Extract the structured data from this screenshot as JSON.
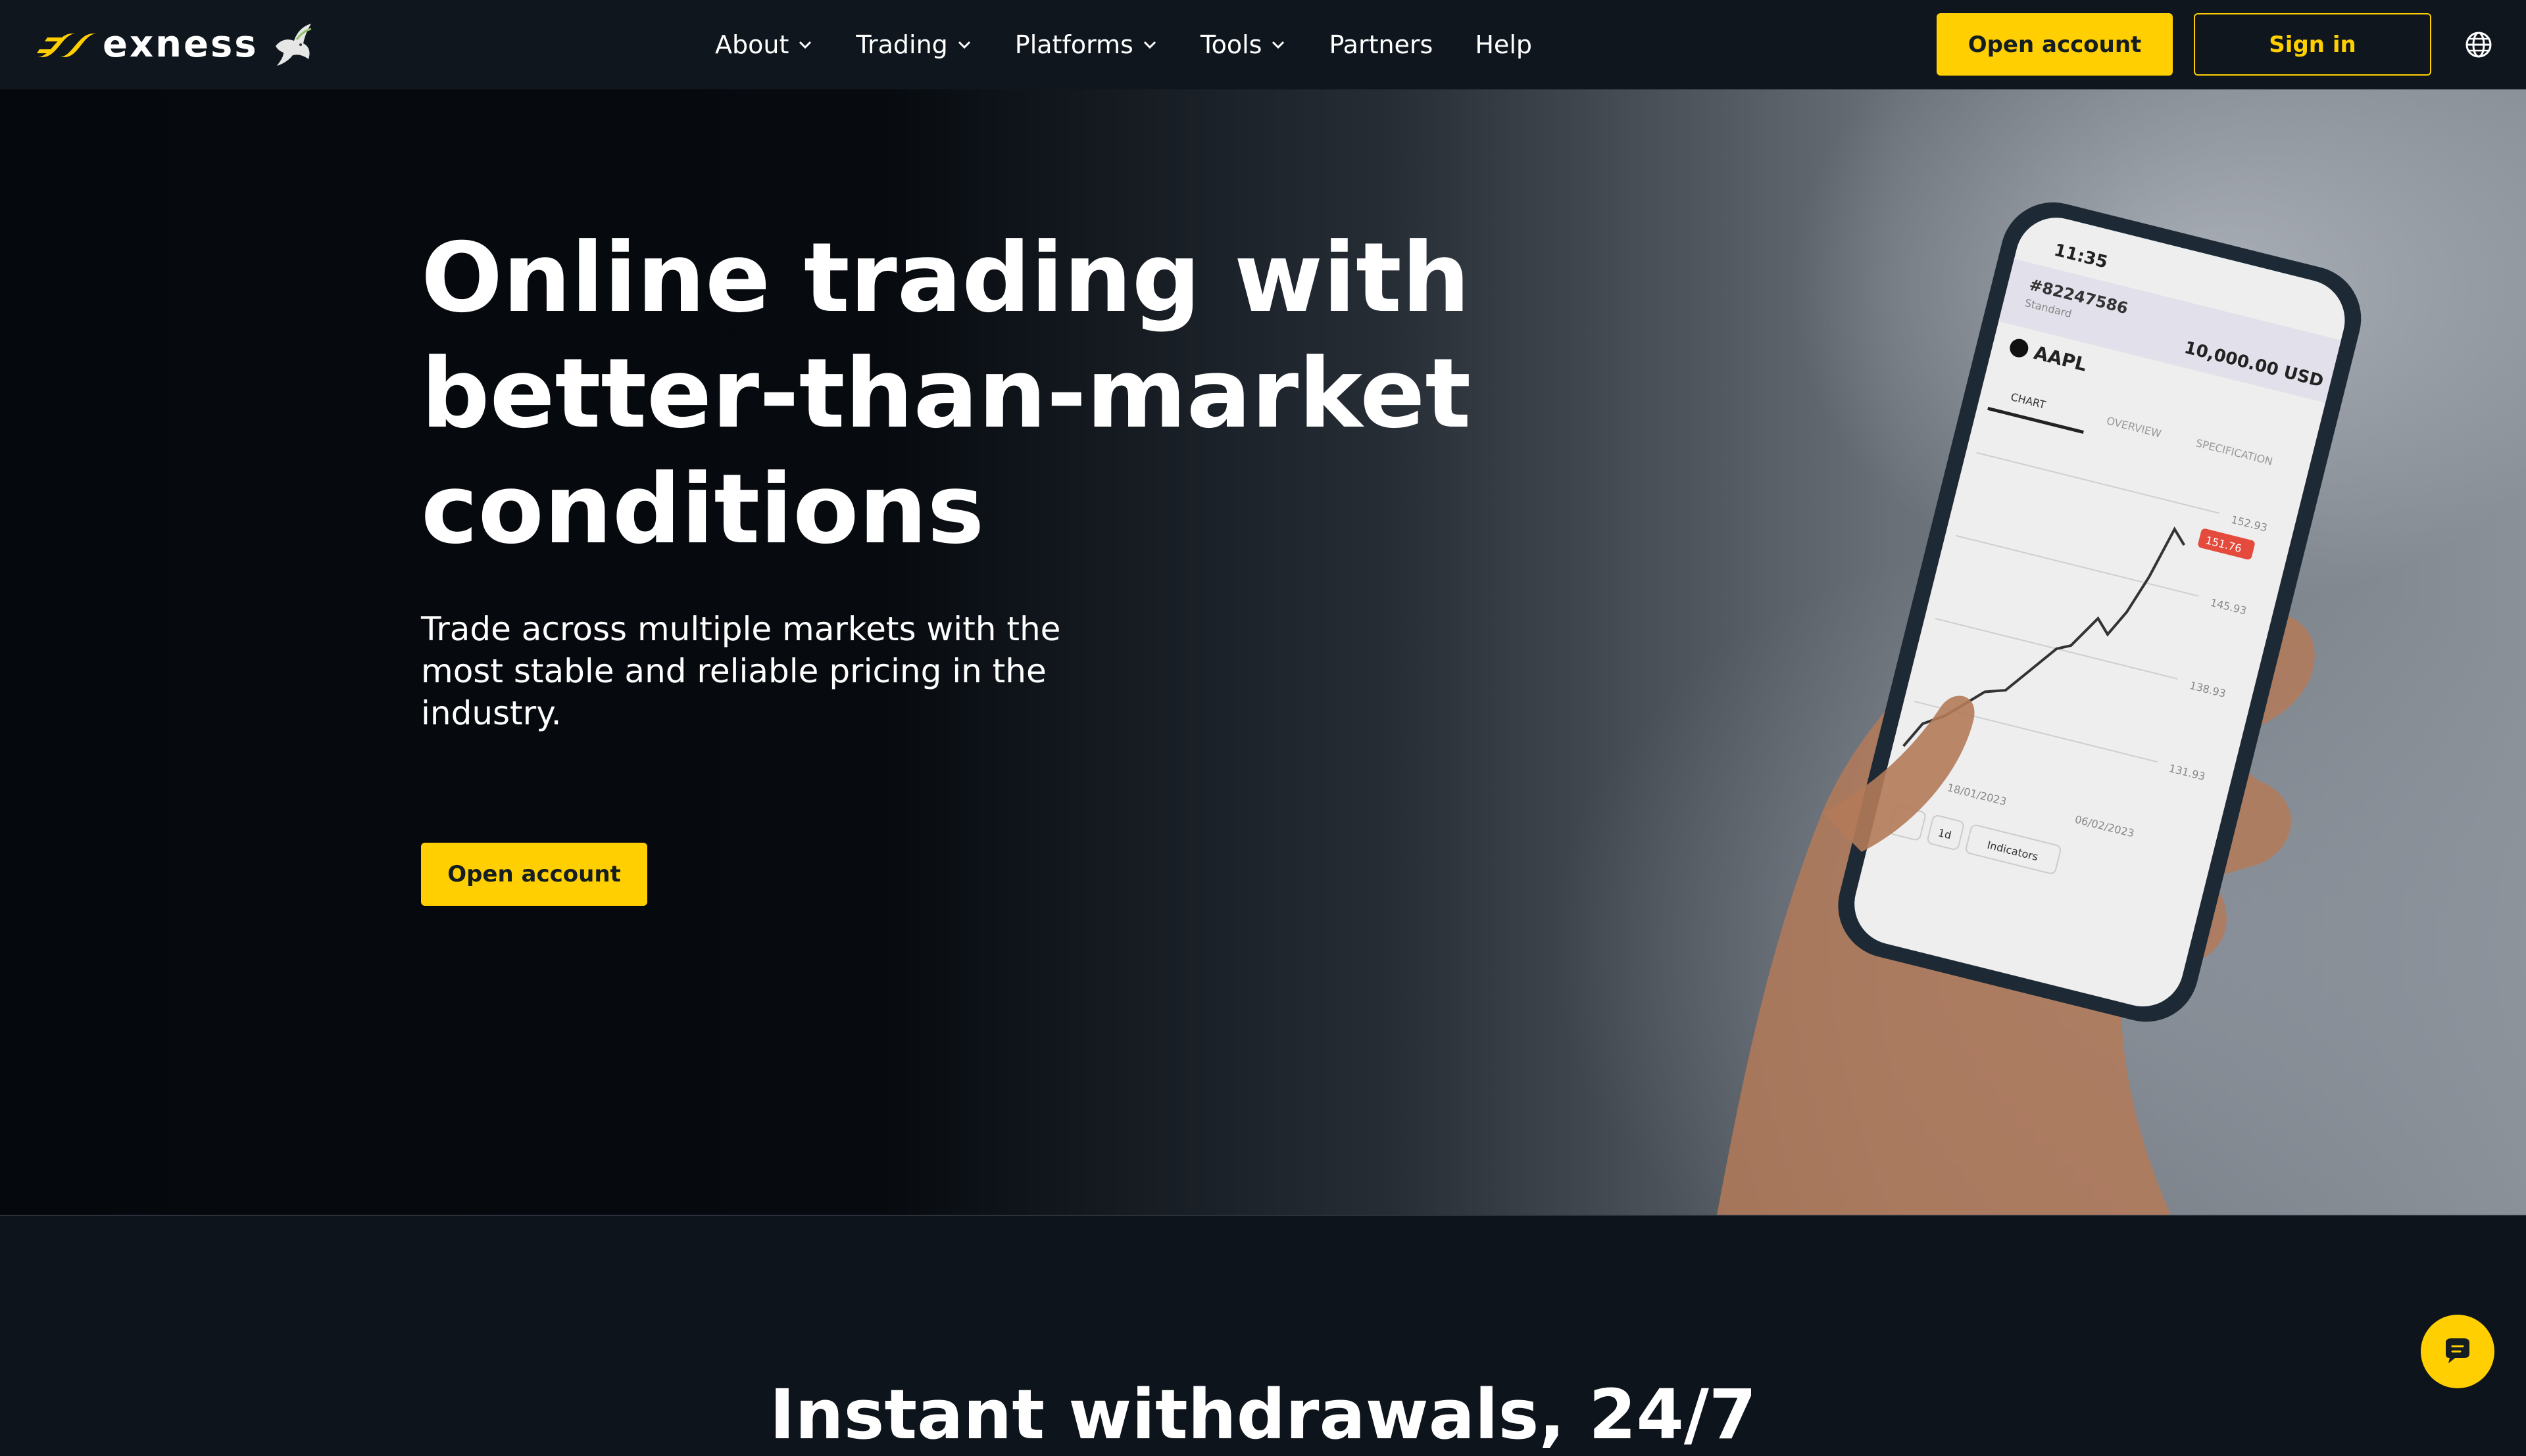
{
  "brand": {
    "name": "exness",
    "accent": "#ffcf01",
    "background": "#0e141b"
  },
  "nav": {
    "items": [
      {
        "label": "About"
      },
      {
        "label": "Trading"
      },
      {
        "label": "Platforms"
      },
      {
        "label": "Tools"
      },
      {
        "label": "Partners"
      },
      {
        "label": "Help"
      }
    ]
  },
  "header": {
    "open_account_label": "Open account",
    "sign_in_label": "Sign in",
    "language_icon": "globe-icon"
  },
  "hero": {
    "title": "Online trading with better-than-market conditions",
    "subtitle": "Trade across multiple markets with the most stable and reliable pricing in the industry.",
    "cta_label": "Open account",
    "phone": {
      "time": "11:35",
      "account": "#82247586",
      "account_type": "Standard",
      "balance": "10,000.00 USD",
      "symbol": "AAPL",
      "tabs": [
        "CHART",
        "OVERVIEW",
        "SPECIFICATION"
      ],
      "price_tag": "151.76",
      "price_levels": [
        "152.93",
        "145.93",
        "138.93",
        "131.93"
      ],
      "dates": [
        "18/01/2023",
        "06/02/2023"
      ],
      "toolbar": [
        "1d",
        "Indicators"
      ]
    }
  },
  "next_section": {
    "heading": "Instant withdrawals, 24/7"
  },
  "chat": {
    "icon": "chat-bubble-icon"
  }
}
